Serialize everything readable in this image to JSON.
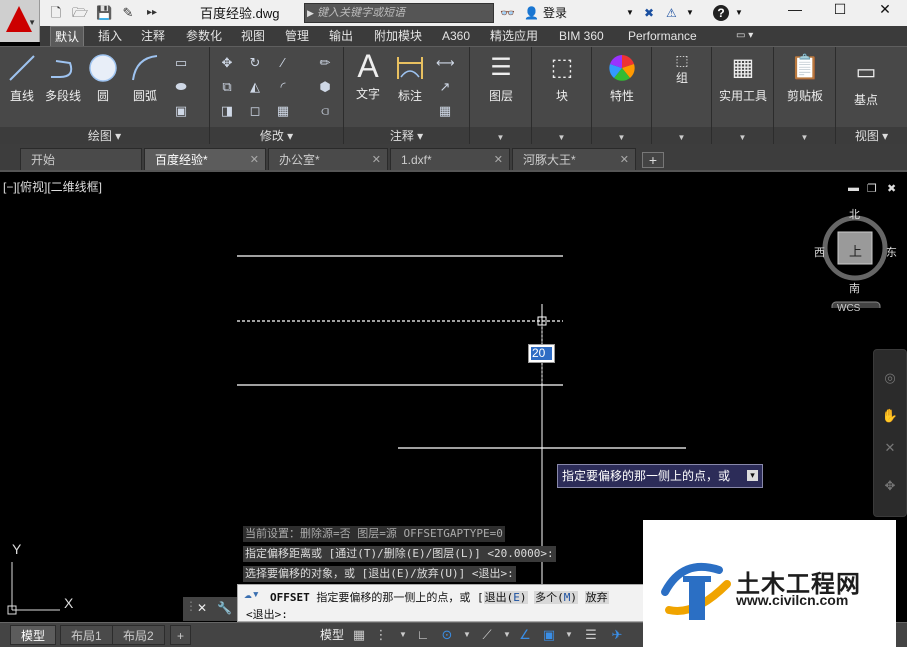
{
  "titlebar": {
    "doc_title": "百度经验.dwg",
    "search_placeholder": "键入关键字或短语",
    "signin_label": "登录",
    "help_label": "?",
    "minimize": "—",
    "maximize": "☐",
    "close": "✕"
  },
  "ribbon_tabs": [
    {
      "label": "默认"
    },
    {
      "label": "插入"
    },
    {
      "label": "注释"
    },
    {
      "label": "参数化"
    },
    {
      "label": "视图"
    },
    {
      "label": "管理"
    },
    {
      "label": "输出"
    },
    {
      "label": "附加模块"
    },
    {
      "label": "A360"
    },
    {
      "label": "精选应用"
    },
    {
      "label": "BIM 360"
    },
    {
      "label": "Performance"
    }
  ],
  "ribbon": {
    "draw": {
      "line": "直线",
      "polyline": "多段线",
      "circle": "圆",
      "arc": "圆弧",
      "title": "绘图 ▾"
    },
    "modify": {
      "title": "修改 ▾"
    },
    "annotation": {
      "text": "文字",
      "dimension": "标注",
      "title": "注释 ▾"
    },
    "layers": {
      "label": "图层"
    },
    "block": {
      "label": "块"
    },
    "properties": {
      "label": "特性"
    },
    "groups": {
      "label": "组"
    },
    "utilities": {
      "label": "实用工具"
    },
    "clipboard": {
      "label": "剪贴板"
    },
    "base": {
      "label": "基点"
    },
    "view": {
      "title": "视图 ▾"
    }
  },
  "file_tabs": [
    {
      "label": "开始"
    },
    {
      "label": "百度经验*"
    },
    {
      "label": "办公室*"
    },
    {
      "label": "1.dxf*"
    },
    {
      "label": "河豚大王*"
    }
  ],
  "viewport": {
    "label": "[−][俯视][二维线框]",
    "north": "北",
    "south": "南",
    "east": "东",
    "west": "西",
    "top_face": "上",
    "wcs": "WCS"
  },
  "dynamic_input_value": "20",
  "tooltip_text": "指定要偏移的那一侧上的点，或",
  "command_history": [
    "当前设置：删除源=否  图层=源  OFFSETGAPTYPE=0",
    "指定偏移距离或 [通过(T)/删除(E)/图层(L)] <20.0000>:",
    "选择要偏移的对象，或 [退出(E)/放弃(U)] <退出>:"
  ],
  "command_input": {
    "command": "OFFSET",
    "prompt": "指定要偏移的那一侧上的点，或 [",
    "opt1": "退出(",
    "opt1_key": "E",
    "opt1_end": ")",
    "opt2": "多个(",
    "opt2_key": "M",
    "opt2_end": ")",
    "opt3": "放弃",
    "row2": "<退出>:"
  },
  "layout_tabs": [
    {
      "label": "模型"
    },
    {
      "label": "布局1"
    },
    {
      "label": "布局2"
    }
  ],
  "status": {
    "model_label": "模型"
  },
  "watermark": {
    "title": "土木工程网",
    "url": "www.civilcn.com"
  },
  "colors": {
    "accent": "#2e6cc4",
    "tooltip_bg": "#2c2c58",
    "ribbon_bg": "#484848"
  }
}
